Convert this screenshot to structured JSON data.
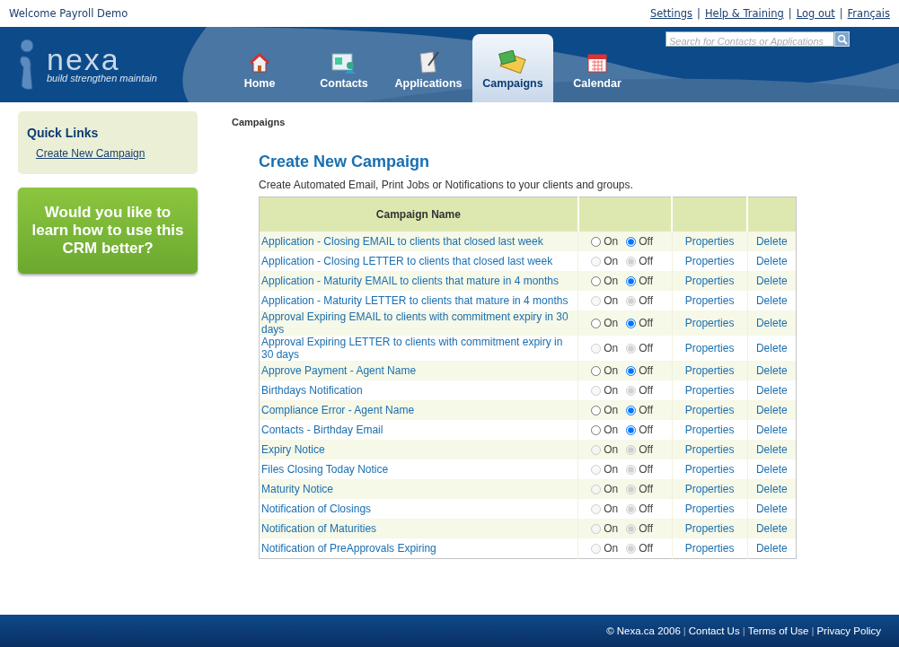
{
  "top_bar": {
    "welcome": "Welcome Payroll Demo",
    "separator": "|",
    "links": [
      "Settings",
      "Help & Training",
      "Log out",
      "Français"
    ]
  },
  "logo": {
    "name": "nexa",
    "tagline": "build strengthen maintain"
  },
  "search": {
    "placeholder": "Search for Contacts or Applications"
  },
  "tabs": [
    {
      "label": "Home",
      "kind": "home",
      "selected": false
    },
    {
      "label": "Contacts",
      "kind": "contacts",
      "selected": false
    },
    {
      "label": "Applications",
      "kind": "applications",
      "selected": false
    },
    {
      "label": "Campaigns",
      "kind": "campaigns",
      "selected": true
    },
    {
      "label": "Calendar",
      "kind": "calendar",
      "selected": false
    }
  ],
  "quick_links": {
    "title": "Quick Links",
    "links": [
      "Create New Campaign"
    ]
  },
  "promo": {
    "text": "Would you like to learn how to use this CRM better?"
  },
  "breadcrumb": "Campaigns",
  "page": {
    "title": "Create New Campaign",
    "description": "Create Automated Email, Print Jobs or Notifications to your clients and groups."
  },
  "table": {
    "columns": [
      "Campaign Name"
    ],
    "rows": [
      {
        "name": "Application - Closing EMAIL to clients that closed last week",
        "active": false,
        "disabled": false,
        "on_label": "On",
        "off_label": "Off",
        "properties": "Properties",
        "delete": "Delete"
      },
      {
        "name": "Application - Closing LETTER to clients that closed last week",
        "active": false,
        "disabled": true,
        "on_label": "On",
        "off_label": "Off",
        "properties": "Properties",
        "delete": "Delete"
      },
      {
        "name": "Application - Maturity EMAIL to clients that mature in 4 months",
        "active": false,
        "disabled": false,
        "on_label": "On",
        "off_label": "Off",
        "properties": "Properties",
        "delete": "Delete"
      },
      {
        "name": "Application - Maturity LETTER to clients that mature in 4 months",
        "active": false,
        "disabled": true,
        "on_label": "On",
        "off_label": "Off",
        "properties": "Properties",
        "delete": "Delete"
      },
      {
        "name": "Approval Expiring EMAIL to clients with commitment expiry in 30 days",
        "active": false,
        "disabled": false,
        "on_label": "On",
        "off_label": "Off",
        "properties": "Properties",
        "delete": "Delete"
      },
      {
        "name": "Approval Expiring LETTER to clients with commitment expiry in 30 days",
        "active": false,
        "disabled": true,
        "on_label": "On",
        "off_label": "Off",
        "properties": "Properties",
        "delete": "Delete"
      },
      {
        "name": "Approve Payment - Agent Name",
        "active": false,
        "disabled": false,
        "on_label": "On",
        "off_label": "Off",
        "properties": "Properties",
        "delete": "Delete"
      },
      {
        "name": "Birthdays Notification",
        "active": false,
        "disabled": true,
        "on_label": "On",
        "off_label": "Off",
        "properties": "Properties",
        "delete": "Delete"
      },
      {
        "name": "Compliance Error - Agent Name",
        "active": false,
        "disabled": false,
        "on_label": "On",
        "off_label": "Off",
        "properties": "Properties",
        "delete": "Delete"
      },
      {
        "name": "Contacts - Birthday Email",
        "active": false,
        "disabled": false,
        "on_label": "On",
        "off_label": "Off",
        "properties": "Properties",
        "delete": "Delete"
      },
      {
        "name": "Expiry Notice",
        "active": false,
        "disabled": true,
        "on_label": "On",
        "off_label": "Off",
        "properties": "Properties",
        "delete": "Delete"
      },
      {
        "name": "Files Closing Today Notice",
        "active": false,
        "disabled": true,
        "on_label": "On",
        "off_label": "Off",
        "properties": "Properties",
        "delete": "Delete"
      },
      {
        "name": "Maturity Notice",
        "active": false,
        "disabled": true,
        "on_label": "On",
        "off_label": "Off",
        "properties": "Properties",
        "delete": "Delete"
      },
      {
        "name": "Notification of Closings",
        "active": false,
        "disabled": true,
        "on_label": "On",
        "off_label": "Off",
        "properties": "Properties",
        "delete": "Delete"
      },
      {
        "name": "Notification of Maturities",
        "active": false,
        "disabled": true,
        "on_label": "On",
        "off_label": "Off",
        "properties": "Properties",
        "delete": "Delete"
      },
      {
        "name": "Notification of PreApprovals Expiring",
        "active": false,
        "disabled": true,
        "on_label": "On",
        "off_label": "Off",
        "properties": "Properties",
        "delete": "Delete"
      }
    ]
  },
  "footer": {
    "copyright": "© Nexa.ca 2006",
    "separator": "|",
    "links": [
      "Contact Us",
      "Terms of Use",
      "Privacy Policy"
    ]
  }
}
